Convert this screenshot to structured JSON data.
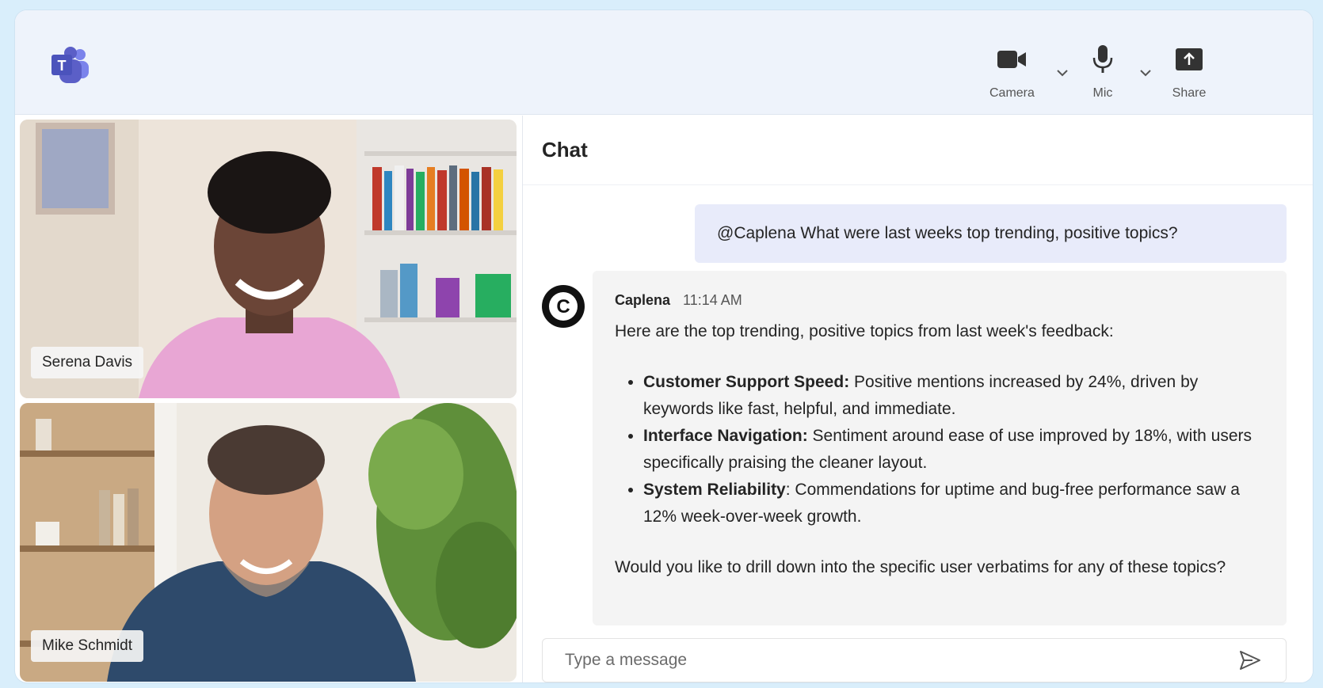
{
  "toolbar": {
    "camera_label": "Camera",
    "mic_label": "Mic",
    "share_label": "Share"
  },
  "participants": [
    {
      "name": "Serena Davis"
    },
    {
      "name": "Mike Schmidt"
    }
  ],
  "chat": {
    "title": "Chat",
    "user_message": "@Caplena What were last weeks top trending, positive topics?",
    "bot": {
      "avatar_letter": "C",
      "sender": "Caplena",
      "time": "11:14 AM",
      "intro": "Here are the top trending, positive topics from last week's feedback:",
      "items": [
        {
          "title": "Customer Support Speed:",
          "text": " Positive mentions increased by 24%, driven by keywords like fast, helpful, and immediate."
        },
        {
          "title": "Interface Navigation:",
          "text": " Sentiment around ease of use improved by 18%, with users specifically praising the cleaner layout."
        },
        {
          "title": "System Reliability",
          "text": ": Commendations for uptime and bug-free performance saw a 12% week-over-week growth."
        }
      ],
      "outro": "Would you like to drill down into the specific user verbatims for any of these topics?"
    },
    "composer_placeholder": "Type a message"
  },
  "colors": {
    "accent": "#5b5fc7",
    "user_bubble": "#e8ebfa",
    "bot_bubble": "#f4f4f4"
  }
}
